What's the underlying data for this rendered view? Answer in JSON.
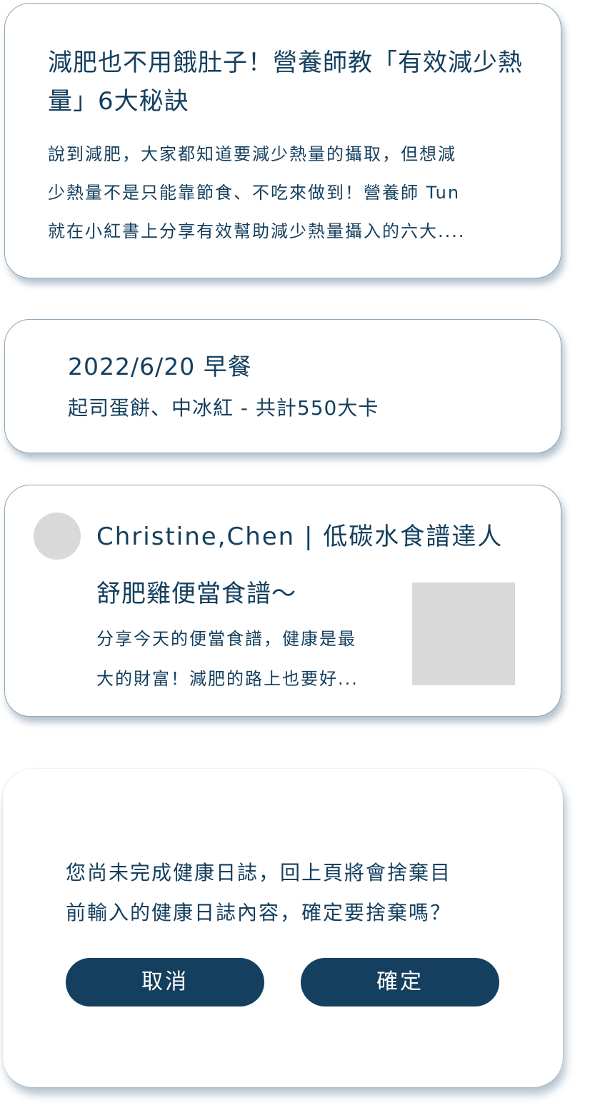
{
  "article_card": {
    "title": "減肥也不用餓肚子！營養師教「有效減少熱量」6大秘訣",
    "excerpt_lines": [
      "說到減肥，大家都知道要減少熱量的攝取，但想減",
      "少熱量不是只能靠節食、不吃來做到！營養師 Tun",
      "就在小紅書上分享有效幫助減少熱量攝入的六大...."
    ]
  },
  "meal_card": {
    "date_label": "2022/6/20 早餐",
    "detail": "起司蛋餅、中冰紅 - 共計550大卡"
  },
  "post_card": {
    "author": "Christine,Chen | 低碳水食譜達人",
    "title": "舒肥雞便當食譜～",
    "excerpt_lines": [
      "分享今天的便當食譜，健康是最",
      "大的財富！減肥的路上也要好..."
    ]
  },
  "dialog": {
    "message_lines": [
      "您尚未完成健康日誌，回上頁將會捨棄目",
      "前輸入的健康日誌內容，確定要捨棄嗎？"
    ],
    "cancel_label": "取消",
    "confirm_label": "確定"
  },
  "colors": {
    "primary": "#143F5E",
    "card_border": "#8FA7B8",
    "placeholder_gray": "#D9D9D9",
    "background": "#FFFFFF"
  }
}
